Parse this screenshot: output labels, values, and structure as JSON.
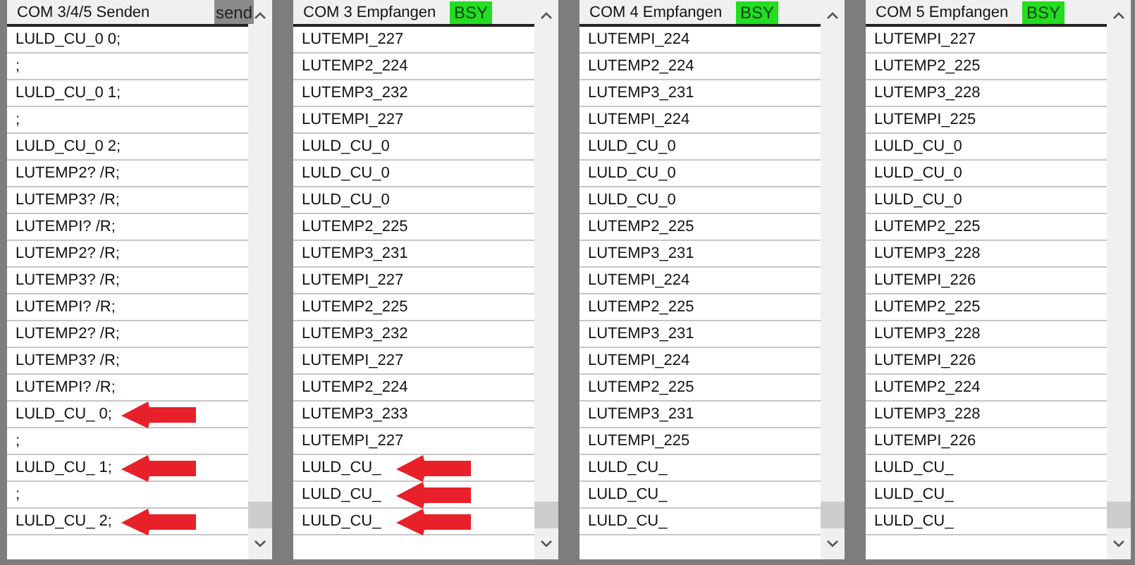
{
  "panels": [
    {
      "title": "COM 3/4/5 Senden",
      "badge": {
        "label": "send",
        "kind": "button"
      },
      "rows": [
        {
          "text": "LULD_CU_0 0;",
          "arrow": false
        },
        {
          "text": ";",
          "arrow": false
        },
        {
          "text": "LULD_CU_0 1;",
          "arrow": false
        },
        {
          "text": ";",
          "arrow": false
        },
        {
          "text": "LULD_CU_0 2;",
          "arrow": false
        },
        {
          "text": "LUTEMP2? /R;",
          "arrow": false
        },
        {
          "text": "LUTEMP3? /R;",
          "arrow": false
        },
        {
          "text": "LUTEMPI? /R;",
          "arrow": false
        },
        {
          "text": "LUTEMP2? /R;",
          "arrow": false
        },
        {
          "text": "LUTEMP3? /R;",
          "arrow": false
        },
        {
          "text": "LUTEMPI? /R;",
          "arrow": false
        },
        {
          "text": "LUTEMP2? /R;",
          "arrow": false
        },
        {
          "text": "LUTEMP3? /R;",
          "arrow": false
        },
        {
          "text": "LUTEMPI? /R;",
          "arrow": false
        },
        {
          "text": "LULD_CU_ 0;",
          "arrow": true
        },
        {
          "text": ";",
          "arrow": false
        },
        {
          "text": "LULD_CU_ 1;",
          "arrow": true
        },
        {
          "text": ";",
          "arrow": false
        },
        {
          "text": "LULD_CU_ 2;",
          "arrow": true
        }
      ]
    },
    {
      "title": "COM 3 Empfangen",
      "badge": {
        "label": "BSY",
        "kind": "status"
      },
      "rows": [
        {
          "text": "LUTEMPI_227",
          "arrow": false
        },
        {
          "text": "LUTEMP2_224",
          "arrow": false
        },
        {
          "text": "LUTEMP3_232",
          "arrow": false
        },
        {
          "text": "LUTEMPI_227",
          "arrow": false
        },
        {
          "text": "LULD_CU_0",
          "arrow": false
        },
        {
          "text": "LULD_CU_0",
          "arrow": false
        },
        {
          "text": "LULD_CU_0",
          "arrow": false
        },
        {
          "text": "LUTEMP2_225",
          "arrow": false
        },
        {
          "text": "LUTEMP3_231",
          "arrow": false
        },
        {
          "text": "LUTEMPI_227",
          "arrow": false
        },
        {
          "text": "LUTEMP2_225",
          "arrow": false
        },
        {
          "text": "LUTEMP3_232",
          "arrow": false
        },
        {
          "text": "LUTEMPI_227",
          "arrow": false
        },
        {
          "text": "LUTEMP2_224",
          "arrow": false
        },
        {
          "text": "LUTEMP3_233",
          "arrow": false
        },
        {
          "text": "LUTEMPI_227",
          "arrow": false
        },
        {
          "text": "LULD_CU_",
          "arrow": true
        },
        {
          "text": "LULD_CU_",
          "arrow": true
        },
        {
          "text": "LULD_CU_",
          "arrow": true
        }
      ]
    },
    {
      "title": "COM 4 Empfangen",
      "badge": {
        "label": "BSY",
        "kind": "status"
      },
      "rows": [
        {
          "text": "LUTEMPI_224",
          "arrow": false
        },
        {
          "text": "LUTEMP2_224",
          "arrow": false
        },
        {
          "text": "LUTEMP3_231",
          "arrow": false
        },
        {
          "text": "LUTEMPI_224",
          "arrow": false
        },
        {
          "text": "LULD_CU_0",
          "arrow": false
        },
        {
          "text": "LULD_CU_0",
          "arrow": false
        },
        {
          "text": "LULD_CU_0",
          "arrow": false
        },
        {
          "text": "LUTEMP2_225",
          "arrow": false
        },
        {
          "text": "LUTEMP3_231",
          "arrow": false
        },
        {
          "text": "LUTEMPI_224",
          "arrow": false
        },
        {
          "text": "LUTEMP2_225",
          "arrow": false
        },
        {
          "text": "LUTEMP3_231",
          "arrow": false
        },
        {
          "text": "LUTEMPI_224",
          "arrow": false
        },
        {
          "text": "LUTEMP2_225",
          "arrow": false
        },
        {
          "text": "LUTEMP3_231",
          "arrow": false
        },
        {
          "text": "LUTEMPI_225",
          "arrow": false
        },
        {
          "text": "LULD_CU_",
          "arrow": false
        },
        {
          "text": "LULD_CU_",
          "arrow": false
        },
        {
          "text": "LULD_CU_",
          "arrow": false
        }
      ]
    },
    {
      "title": "COM 5 Empfangen",
      "badge": {
        "label": "BSY",
        "kind": "status"
      },
      "rows": [
        {
          "text": "LUTEMPI_227",
          "arrow": false
        },
        {
          "text": "LUTEMP2_225",
          "arrow": false
        },
        {
          "text": "LUTEMP3_228",
          "arrow": false
        },
        {
          "text": "LUTEMPI_225",
          "arrow": false
        },
        {
          "text": "LULD_CU_0",
          "arrow": false
        },
        {
          "text": "LULD_CU_0",
          "arrow": false
        },
        {
          "text": "LULD_CU_0",
          "arrow": false
        },
        {
          "text": "LUTEMP2_225",
          "arrow": false
        },
        {
          "text": "LUTEMP3_228",
          "arrow": false
        },
        {
          "text": "LUTEMPI_226",
          "arrow": false
        },
        {
          "text": "LUTEMP2_225",
          "arrow": false
        },
        {
          "text": "LUTEMP3_228",
          "arrow": false
        },
        {
          "text": "LUTEMPI_226",
          "arrow": false
        },
        {
          "text": "LUTEMP2_224",
          "arrow": false
        },
        {
          "text": "LUTEMP3_228",
          "arrow": false
        },
        {
          "text": "LUTEMPI_226",
          "arrow": false
        },
        {
          "text": "LULD_CU_",
          "arrow": false
        },
        {
          "text": "LULD_CU_",
          "arrow": false
        },
        {
          "text": "LULD_CU_",
          "arrow": false
        }
      ]
    }
  ]
}
